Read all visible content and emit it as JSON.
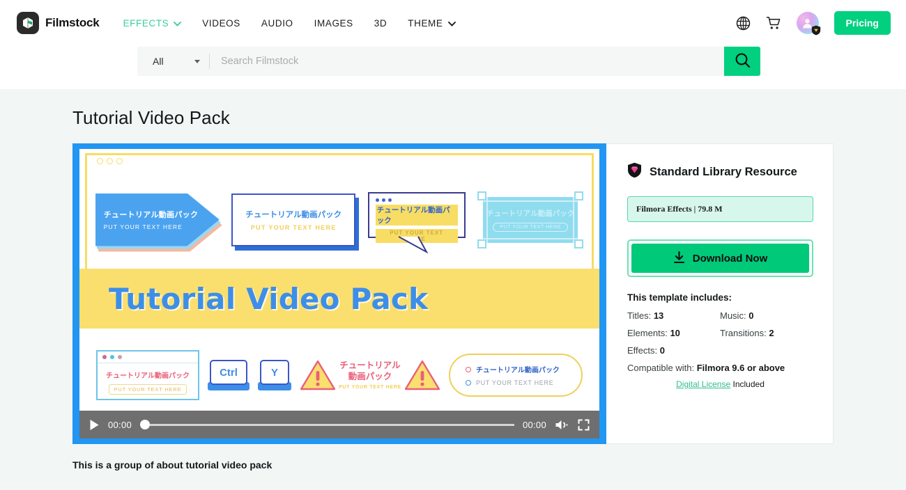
{
  "header": {
    "brand": "Filmstock",
    "logo_icon": "filmstock-cube-icon",
    "nav": [
      {
        "label": "EFFECTS",
        "active": true,
        "has_caret": true
      },
      {
        "label": "VIDEOS",
        "active": false,
        "has_caret": false
      },
      {
        "label": "AUDIO",
        "active": false,
        "has_caret": false
      },
      {
        "label": "IMAGES",
        "active": false,
        "has_caret": false
      },
      {
        "label": "3D",
        "active": false,
        "has_caret": false
      },
      {
        "label": "THEME",
        "active": false,
        "has_caret": true
      }
    ],
    "globe_icon": "globe-icon",
    "cart_icon": "cart-icon",
    "avatar_icon": "user-avatar",
    "avatar_badge_icon": "shield-badge-icon",
    "pricing_label": "Pricing",
    "accent_green": "#00d07f",
    "active_nav_color": "#3bcf97"
  },
  "search": {
    "category": "All",
    "placeholder": "Search Filmstock",
    "value": "",
    "button_icon": "search-icon"
  },
  "main": {
    "page_title": "Tutorial Video Pack",
    "caption": "This is a group of about tutorial video pack"
  },
  "preview": {
    "row_top": [
      {
        "jp": "チュートリアル動画パック",
        "en": "PUT YOUR TEXT HERE",
        "style": "arrow-banner"
      },
      {
        "jp": "チュートリアル動画パック",
        "en": "PUT YOUR TEXT HERE",
        "style": "box-banner"
      },
      {
        "jp": "チュートリアル動画パック",
        "en": "PUT YOUR TEXT HERE",
        "style": "speech-bubble"
      },
      {
        "jp": "チュートリアル動画パック",
        "en": "PUT YOUR TEXT HERE",
        "style": "selected-box"
      }
    ],
    "banner_title": "Tutorial Video Pack",
    "row_bottom": {
      "window_jp": "チュートリアル動画パック",
      "window_en": "PUT YOUR TEXT HERE",
      "key1": "Ctrl",
      "key2": "Y",
      "warn_jp_line1": "チュートリアル",
      "warn_jp_line2": "動画パック",
      "warn_en": "PUT YOUR TEXT HERE",
      "pill_jp": "チュートリアル動画パック",
      "pill_en": "PUT YOUR TEXT HERE"
    },
    "colors": {
      "frame_blue": "#2196f3",
      "band_yellow": "#fadf6e",
      "title_blue": "#3d8ee8"
    }
  },
  "player": {
    "play_icon": "play-icon",
    "current_time": "00:00",
    "duration": "00:00",
    "volume_icon": "volume-icon",
    "fullscreen_icon": "fullscreen-icon",
    "progress_percent": 0
  },
  "panel": {
    "resource_icon": "shield-diamond-icon",
    "resource_title": "Standard Library Resource",
    "tag": "Filmora Effects | 79.8 M",
    "download_icon": "download-icon",
    "download_label": "Download Now",
    "includes_title": "This template includes:",
    "includes": [
      {
        "label": "Titles:",
        "value": "13"
      },
      {
        "label": "Music:",
        "value": "0"
      },
      {
        "label": "Elements:",
        "value": "10"
      },
      {
        "label": "Transitions:",
        "value": "2"
      },
      {
        "label": "Effects:",
        "value": "0"
      }
    ],
    "compat_label": "Compatible with:",
    "compat_value": "Filmora 9.6 or above",
    "license_link": "Digital License",
    "license_suffix": "Included"
  }
}
